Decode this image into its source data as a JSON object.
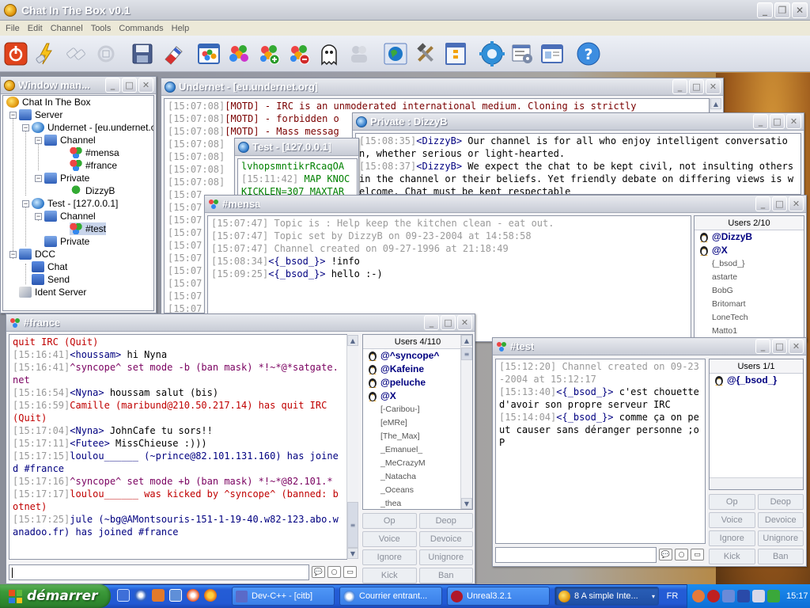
{
  "app": {
    "title": "Chat In The Box v0.1"
  },
  "menu": [
    "File",
    "Edit",
    "Channel",
    "Tools",
    "Commands",
    "Help"
  ],
  "toolbar_icons": [
    "power-icon",
    "connect-icon",
    "disconnect-icon",
    "reconnect-icon",
    "save-icon",
    "eraser-icon",
    "window-icon",
    "users-icon",
    "add-users-icon",
    "remove-users-icon",
    "ghost-icon",
    "dcc-icon",
    "globe-icon",
    "tools-icon",
    "panel-icon",
    "settings-gear-icon",
    "options-icon",
    "browser-window-icon",
    "help-icon"
  ],
  "window_manager": {
    "title": "Window man...",
    "tree": [
      "Chat In The Box",
      "Server",
      "Undernet - [eu.undernet.org]",
      "Channel",
      "#mensa",
      "#france",
      "Private",
      "DizzyB",
      "Test - [127.0.0.1]",
      "Channel",
      "#test",
      "Private",
      "DCC",
      "Chat",
      "Send",
      "Ident Server"
    ]
  },
  "undernet": {
    "title": "Undernet - [eu.undernet.org]",
    "lines": [
      {
        "ts": "[15:07:08]",
        "text": "[MOTD] - IRC is an unmoderated international medium. Cloning is strictly"
      },
      {
        "ts": "[15:07:08]",
        "text": "[MOTD] - forbidden o"
      },
      {
        "ts": "[15:07:08]",
        "text": "[MOTD] - Mass messag"
      },
      {
        "ts": "[15:07:08]",
        "text": ""
      },
      {
        "ts": "[15:07:08]",
        "text": ""
      },
      {
        "ts": "[15:07:08]",
        "text": ""
      },
      {
        "ts": "[15:07:08]",
        "text": ""
      },
      {
        "ts": "[15:07",
        "text": ""
      },
      {
        "ts": "[15:07",
        "text": ""
      },
      {
        "ts": "[15:07",
        "text": ""
      },
      {
        "ts": "[15:07",
        "text": ""
      },
      {
        "ts": "[15:07",
        "text": ""
      },
      {
        "ts": "[15:07",
        "text": ""
      },
      {
        "ts": "[15:07",
        "text": ""
      },
      {
        "ts": "[15:07",
        "text": ""
      },
      {
        "ts": "[15:07",
        "text": ""
      },
      {
        "ts": "[15:07",
        "text": ""
      }
    ]
  },
  "private": {
    "title": "Private : DizzyB",
    "lines": [
      {
        "ts": "[15:08:35]",
        "nick": "<DizzyB>",
        "text": " Our channel is for all who enjoy intelligent conversation, whether serious or light-hearted."
      },
      {
        "ts": "[15:08:37]",
        "nick": "<DizzyB>",
        "text": " We expect the chat to be kept civil, not insulting others in the channel or their beliefs. Yet friendly debate on differing views is welcome. Chat must be kept respectable"
      }
    ]
  },
  "test_server": {
    "title": "Test - [127.0.0.1]",
    "lines": [
      {
        "ts": "",
        "text": "lvhopsmntikrRcaqOA"
      },
      {
        "ts": "[15:11:42]",
        "text": " MAP KNOC"
      },
      {
        "ts": "",
        "text": "KICKLEN=307 MAXTAR"
      }
    ]
  },
  "mensa": {
    "title": "#mensa",
    "lines": [
      {
        "ts": "[15:07:47]",
        "text": " Topic is : Help keep the kitchen clean - eat out.",
        "kind": "sys"
      },
      {
        "ts": "[15:07:47]",
        "text": " Topic set by DizzyB on 09-23-2004 at 14:58:58",
        "kind": "sys"
      },
      {
        "ts": "[15:07:47]",
        "text": " Channel created on 09-27-1996 at 21:18:49",
        "kind": "sys"
      },
      {
        "ts": "[15:08:34]",
        "nick": "<{_bsod_}>",
        "text": " !info",
        "kind": "msg"
      },
      {
        "ts": "[15:09:25]",
        "nick": "<{_bsod_}>",
        "text": " hello :-)",
        "kind": "msg"
      }
    ],
    "users_header": "Users 2/10",
    "users": [
      {
        "name": "@DizzyB",
        "op": true
      },
      {
        "name": "@X",
        "op": true
      },
      {
        "name": "{_bsod_}",
        "op": false
      },
      {
        "name": "astarte",
        "op": false
      },
      {
        "name": "BobG",
        "op": false
      },
      {
        "name": "Britomart",
        "op": false
      },
      {
        "name": "LoneTech",
        "op": false
      },
      {
        "name": "Matto1",
        "op": false
      }
    ]
  },
  "france": {
    "title": "#france",
    "lines": [
      {
        "ts": "",
        "text": "quit IRC (Quit)",
        "kind": "red"
      },
      {
        "ts": "[15:16:41]",
        "nick": "<houssam>",
        "text": " hi Nyna",
        "kind": "msg"
      },
      {
        "ts": "[15:16:41]",
        "text": "^syncope^ set mode -b (ban mask) *!~*@*satgate.net",
        "kind": "mode"
      },
      {
        "ts": "[15:16:54]",
        "nick": "<Nyna>",
        "text": " houssam salut (bis)",
        "kind": "msg"
      },
      {
        "ts": "[15:16:59]",
        "text": "Camille (maribund@210.50.217.14) has quit IRC (Quit)",
        "kind": "red"
      },
      {
        "ts": "[15:17:04]",
        "nick": "<Nyna>",
        "text": " JohnCafe tu sors!!",
        "kind": "msg"
      },
      {
        "ts": "[15:17:11]",
        "nick": "<Futee>",
        "text": " MissChieuse :)))",
        "kind": "msg"
      },
      {
        "ts": "[15:17:15]",
        "text": "loulou______ (~prince@82.101.131.160) has joined #france",
        "kind": "join"
      },
      {
        "ts": "[15:17:16]",
        "text": "^syncope^ set mode +b (ban mask) *!~*@82.101.*",
        "kind": "mode"
      },
      {
        "ts": "[15:17:17]",
        "text": "loulou______ was kicked by ^syncope^ (banned: botnet)",
        "kind": "red"
      },
      {
        "ts": "[15:17:25]",
        "text": "jule (~bg@AMontsouris-151-1-19-40.w82-123.abo.wanadoo.fr) has joined #france",
        "kind": "join"
      }
    ],
    "users_header": "Users 4/110",
    "users": [
      {
        "name": "@^syncope^",
        "op": true
      },
      {
        "name": "@Kafeine",
        "op": true
      },
      {
        "name": "@peluche",
        "op": true
      },
      {
        "name": "@X",
        "op": true
      },
      {
        "name": "[-Caribou-]",
        "op": false
      },
      {
        "name": "[eMRe]",
        "op": false
      },
      {
        "name": "[The_Max]",
        "op": false
      },
      {
        "name": "_Emanuel_",
        "op": false
      },
      {
        "name": "_MeCrazyM",
        "op": false
      },
      {
        "name": "_Natacha",
        "op": false
      },
      {
        "name": "_Oceans",
        "op": false
      },
      {
        "name": "_thea",
        "op": false
      }
    ]
  },
  "test_channel": {
    "title": "#test",
    "lines": [
      {
        "ts": "[15:12:20]",
        "text": " Channel created on 09-23-2004 at 15:12:17",
        "kind": "sys"
      },
      {
        "ts": "[15:13:40]",
        "nick": "<{_bsod_}>",
        "text": " c'est chouette d'avoir son propre serveur IRC",
        "kind": "msg"
      },
      {
        "ts": "[15:14:04]",
        "nick": "<{_bsod_}>",
        "text": " comme ça on peut causer sans déranger personne ;oP",
        "kind": "msg"
      }
    ],
    "users_header": "Users 1/1",
    "users": [
      {
        "name": "@{_bsod_}",
        "op": true
      }
    ]
  },
  "buttons": {
    "op": "Op",
    "deop": "Deop",
    "voice": "Voice",
    "devoice": "Devoice",
    "ignore": "Ignore",
    "unignore": "Unignore",
    "kick": "Kick",
    "ban": "Ban"
  },
  "taskbar": {
    "start": "démarrer",
    "tasks": [
      "Dev-C++ - [citb]",
      "Courrier entrant...",
      "Unreal3.2.1",
      "8  A simple Inte..."
    ],
    "lang": "FR",
    "clock": "15:17"
  }
}
